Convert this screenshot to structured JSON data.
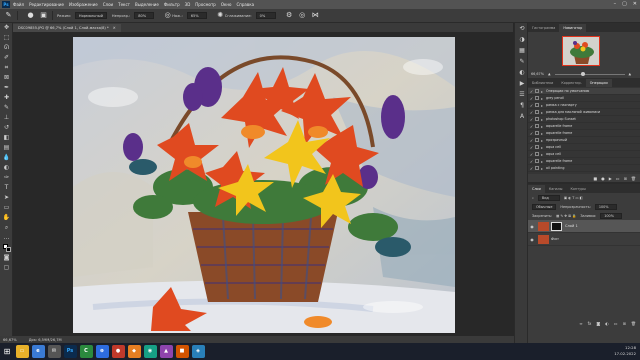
{
  "menu": {
    "logo": "Ps",
    "items": [
      "Файл",
      "Редактирование",
      "Изображение",
      "Слои",
      "Текст",
      "Выделение",
      "Фильтр",
      "3D",
      "Просмотр",
      "Окно",
      "Справка"
    ]
  },
  "options": {
    "mode_label": "Режим:",
    "mode_value": "Нормальный",
    "opacity_label": "Непрозр.:",
    "opacity_value": "80%",
    "flow_label": "Наж.:",
    "flow_value": "65%",
    "smoothing_label": "Сглаживание:",
    "smoothing_value": "0%"
  },
  "document": {
    "tab_title": "DSC09855.JPG @ 66,7% (Слой 1, Слой-маска/8) *"
  },
  "status": {
    "zoom": "66,67%",
    "doc_info": "Док: 6,59М/26,7М"
  },
  "navigator": {
    "tabs": [
      "Гистограмма",
      "Навигатор"
    ],
    "zoom": "66,67%"
  },
  "history": {
    "tabs": [
      "Библиотеки",
      "Корректир.",
      "Операции"
    ],
    "items": [
      "Операции по умолчанию",
      "grey pencil",
      "рамка с паспарту",
      "рамка для масляной живописи",
      "photoshop Sunset",
      "aquarelle frame",
      "aquarelle frame",
      "прозрачный",
      "aqua cell",
      "aqua cell",
      "aquarelle frame",
      "oil painting",
      "карандашный"
    ]
  },
  "layers": {
    "tabs": [
      "Слои",
      "Каналы",
      "Контуры"
    ],
    "filter_label": "Вид",
    "blend_mode": "Обычные",
    "opacity_label": "Непрозрачность:",
    "opacity_value": "100%",
    "lock_label": "Закрепить:",
    "fill_label": "Заливка:",
    "fill_value": "100%",
    "items": [
      {
        "name": "Слой 1",
        "has_mask": true,
        "selected": true
      },
      {
        "name": "Фон",
        "has_mask": false,
        "selected": false
      }
    ]
  },
  "taskbar": {
    "time": "12:28",
    "date": "17.02.2022"
  },
  "colors": {
    "ps_blue": "#31a8ff",
    "panel_bg": "#3c3c3c",
    "taskbar_bg": "#1a1f2b"
  }
}
